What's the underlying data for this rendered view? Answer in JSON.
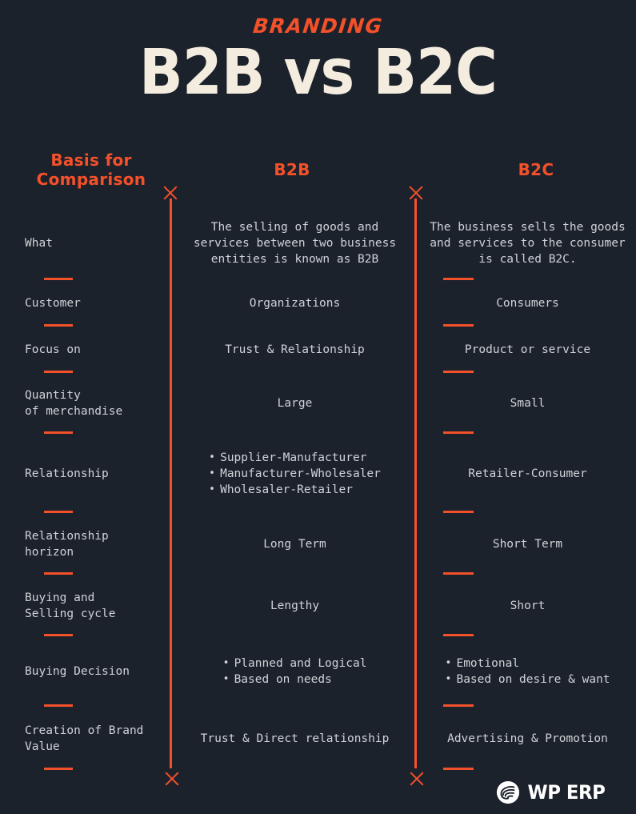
{
  "theme": {
    "background": "#1c222b",
    "accent": "#f4502a",
    "title_color": "#f3ecdf",
    "body_text_color": "#cfd3d8",
    "logo_color": "#ffffff"
  },
  "header": {
    "kicker": "BRANDING",
    "title": "B2B vs B2C"
  },
  "columns": {
    "basis": "Basis for\nComparison",
    "basis_line1": "Basis for",
    "basis_line2": "Comparison",
    "b2b": "B2B",
    "b2c": "B2C"
  },
  "rows": [
    {
      "basis": "What",
      "b2b": "The selling of goods and services between two business entities is known as B2B",
      "b2c": "The business sells the goods and services to the consumer is called B2C."
    },
    {
      "basis": "Customer",
      "b2b": "Organizations",
      "b2c": "Consumers"
    },
    {
      "basis": "Focus on",
      "b2b": "Trust & Relationship",
      "b2c": "Product or service"
    },
    {
      "basis": "Quantity\nof merchandise",
      "b2b": "Large",
      "b2c": "Small"
    },
    {
      "basis": "Relationship",
      "b2b_bullets": [
        "Supplier-Manufacturer",
        "Manufacturer-Wholesaler",
        "Wholesaler-Retailer"
      ],
      "b2c": "Retailer-Consumer"
    },
    {
      "basis": "Relationship\nhorizon",
      "b2b": "Long Term",
      "b2c": "Short Term"
    },
    {
      "basis": "Buying and\nSelling cycle",
      "b2b": "Lengthy",
      "b2c": "Short"
    },
    {
      "basis": "Buying Decision",
      "b2b_bullets": [
        "Planned and Logical",
        "Based on needs"
      ],
      "b2c_bullets": [
        "Emotional",
        "Based on desire & want"
      ]
    },
    {
      "basis": "Creation of Brand\nValue",
      "b2b": "Trust & Direct relationship",
      "b2c": "Advertising & Promotion"
    }
  ],
  "logo": {
    "text": "WP ERP",
    "mark": "wperp-circle-icon"
  },
  "markers": {
    "divider_cap": "x-mark-icon"
  }
}
